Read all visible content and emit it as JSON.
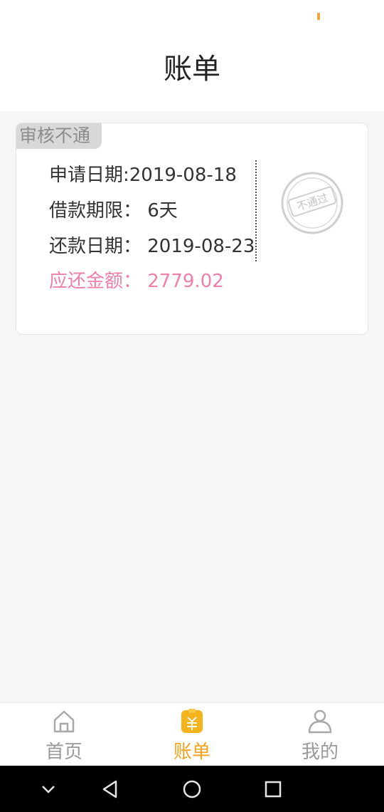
{
  "header": {
    "title": "账单"
  },
  "bill": {
    "status_tag": "审核不通",
    "apply_date": "申请日期:2019-08-18",
    "loan_term": "借款期限：  6天",
    "repay_date": "还款日期：  2019-08-23",
    "amount_due": "应还金额：  2779.02",
    "stamp_text": "不通过"
  },
  "tabs": [
    {
      "label": "首页",
      "icon": "home-icon",
      "active": false
    },
    {
      "label": "账单",
      "icon": "bill-icon",
      "active": true
    },
    {
      "label": "我的",
      "icon": "user-icon",
      "active": false
    }
  ],
  "colors": {
    "accent": "#f5a11c",
    "amount": "#ef7fa6",
    "status_dot": "#f2a33a"
  },
  "system_nav": [
    "chevron-down-icon",
    "back-icon",
    "home-circle-icon",
    "recents-icon"
  ]
}
